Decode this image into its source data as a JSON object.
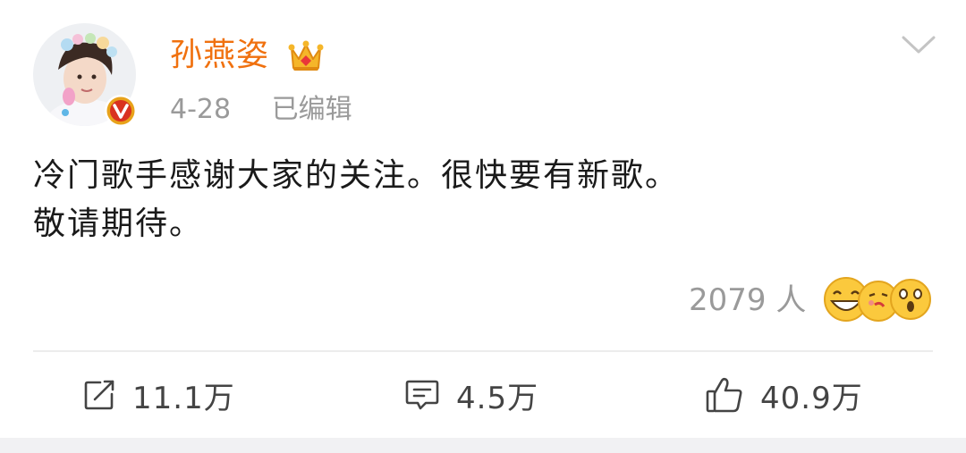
{
  "post": {
    "username": "孙燕姿",
    "date": "4-28",
    "edited_label": "已编辑",
    "text_line1": "冷门歌手感谢大家的关注。很快要有新歌。",
    "text_line2": "敬请期待。"
  },
  "reactions": {
    "count_label": "2079 人",
    "emoji_icons": [
      "laughing-emoji-icon",
      "kiss-emoji-icon",
      "surprised-emoji-icon"
    ]
  },
  "actions": {
    "repost_count": "11.1万",
    "comment_count": "4.5万",
    "like_count": "40.9万"
  },
  "colors": {
    "username": "#f0710f",
    "verified": "#e8a21a",
    "meta": "#9a9a9a"
  }
}
